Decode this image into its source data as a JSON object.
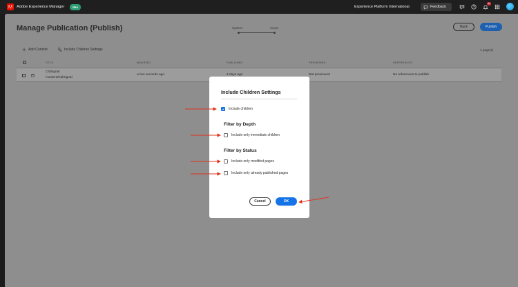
{
  "topbar": {
    "app_name": "Adobe Experience Manager",
    "env_badge": "dev",
    "org_name": "Experience Platform International",
    "feedback_label": "Feedback",
    "notification_count": "9+"
  },
  "page": {
    "title": "Manage Publication (Publish)",
    "stepper": {
      "step1": "Options",
      "step2": "Scope"
    },
    "back_label": "Back",
    "publish_label": "Publish",
    "toolbar": {
      "add_content": "Add Content",
      "include_children_settings": "Include Children Settings"
    },
    "pages_count": "1 page(s)",
    "table": {
      "headers": [
        "TITLE",
        "MODIFIED",
        "PUBLISHED",
        "PREVIEWED",
        "REFERENCES"
      ],
      "rows": [
        {
          "title": "CitiSignal",
          "path": "/content/CitiSignal",
          "modified": "a few seconds ago",
          "published": "4 days ago",
          "previewed": "Not previewed",
          "references": "No references to publish"
        }
      ]
    }
  },
  "dialog": {
    "title": "Include Children Settings",
    "include_children": {
      "label": "Include children",
      "checked": true
    },
    "depth_title": "Filter by Depth",
    "immediate_children": {
      "label": "Include only immediate children",
      "checked": false
    },
    "status_title": "Filter by Status",
    "modified_pages": {
      "label": "Include only modified pages",
      "checked": false
    },
    "published_pages": {
      "label": "Include only already published pages",
      "checked": false
    },
    "cancel_label": "Cancel",
    "ok_label": "OK"
  },
  "colors": {
    "accent": "#1473e6",
    "annotation_arrow": "#e0321e",
    "brand": "#eb1000",
    "env_badge": "#2f9a72"
  }
}
